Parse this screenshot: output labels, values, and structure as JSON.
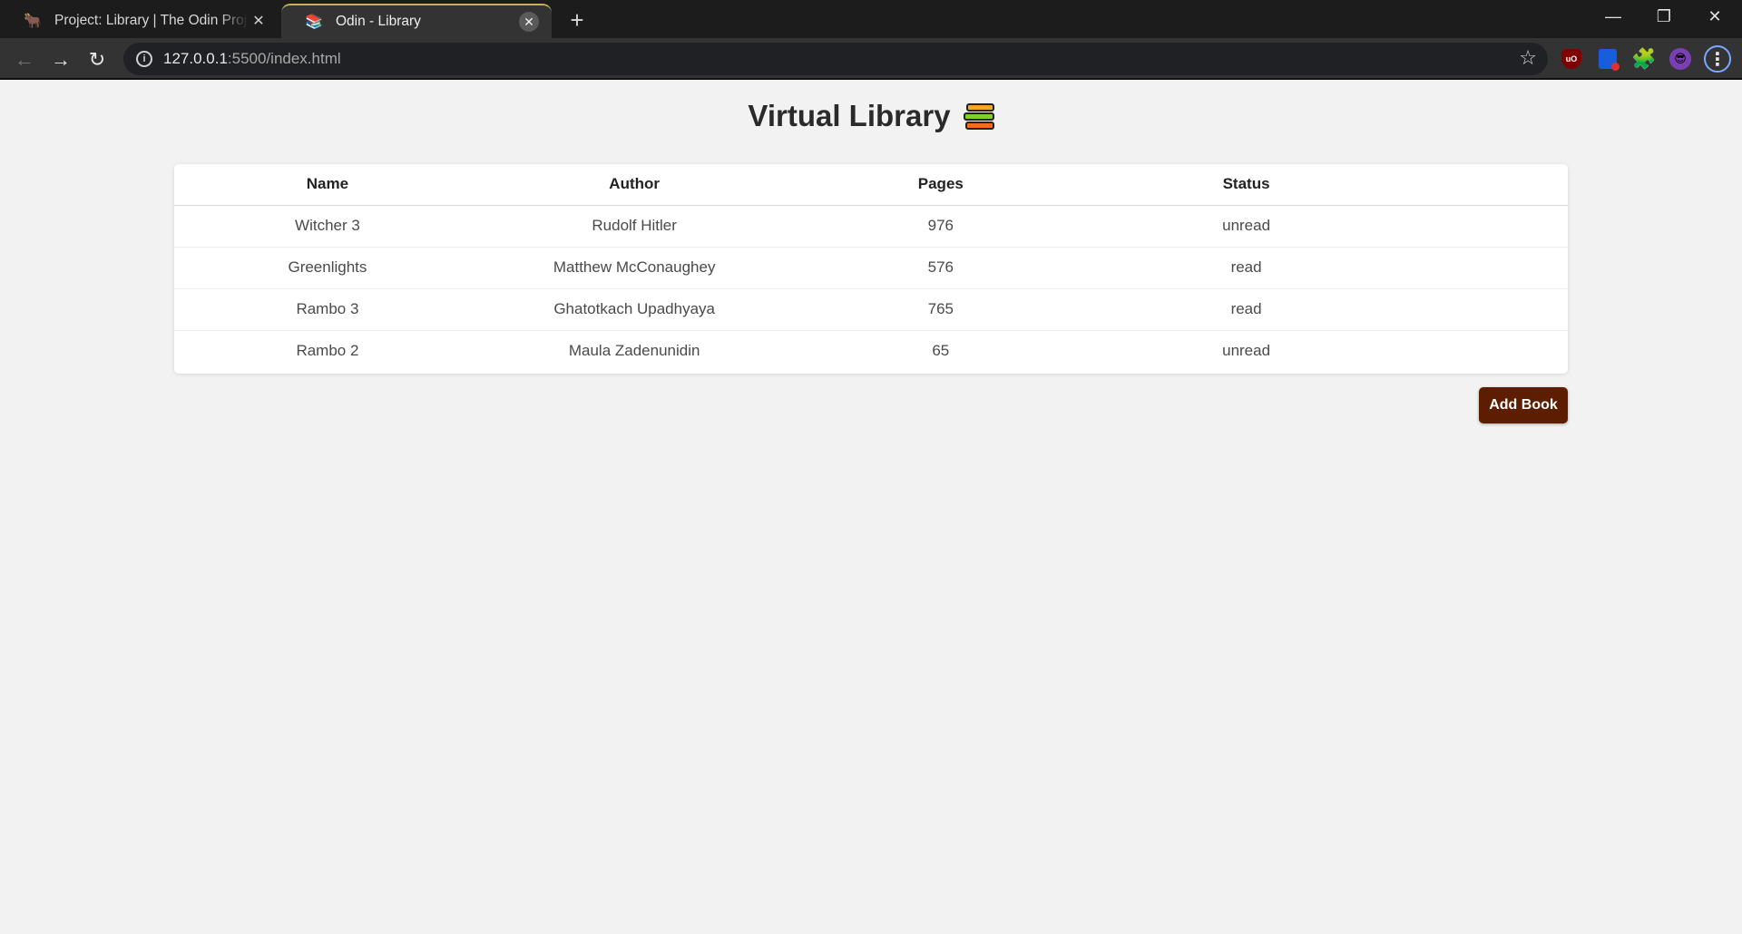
{
  "browser": {
    "tabs": [
      {
        "title": "Project: Library | The Odin Project",
        "favicon": "odin-icon",
        "active": false
      },
      {
        "title": "Odin - Library",
        "favicon": "books-icon",
        "active": true
      }
    ],
    "address": {
      "host": "127.0.0.1",
      "path": ":5500/index.html"
    },
    "colors": {
      "tabbar": "#1c1c1c",
      "toolbar": "#333334",
      "active_tab_accent": "#c9b15a"
    }
  },
  "page": {
    "title": "Virtual Library",
    "title_icon": "books-icon",
    "table": {
      "columns": [
        "Name",
        "Author",
        "Pages",
        "Status"
      ],
      "rows": [
        [
          "Witcher 3",
          "Rudolf Hitler",
          "976",
          "unread"
        ],
        [
          "Greenlights",
          "Matthew McConaughey",
          "576",
          "read"
        ],
        [
          "Rambo 3",
          "Ghatotkach Upadhyaya",
          "765",
          "read"
        ],
        [
          "Rambo 2",
          "Maula Zadenunidin",
          "65",
          "unread"
        ]
      ]
    },
    "add_button_label": "Add Book",
    "colors": {
      "background": "#f2f2f2",
      "button": "#5c1d00"
    }
  }
}
